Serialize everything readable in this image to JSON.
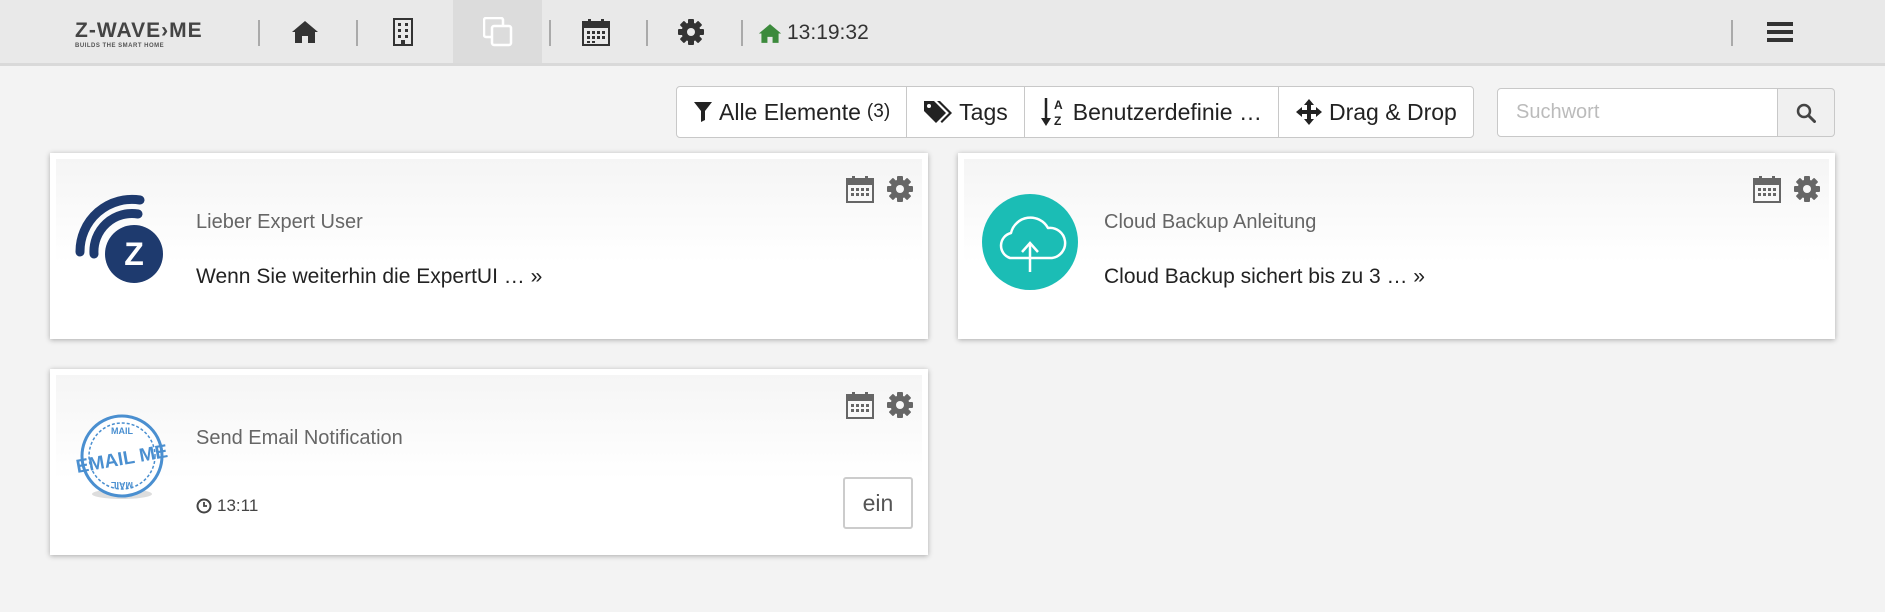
{
  "header": {
    "logo": {
      "name": "Z-WAVE›ME",
      "tagline": "BUILDS THE SMART HOME"
    },
    "nav": [
      {
        "icon": "home-icon"
      },
      {
        "icon": "building-icon"
      },
      {
        "icon": "elements-icon",
        "active": true
      },
      {
        "icon": "calendar-icon"
      },
      {
        "icon": "gear-icon"
      }
    ],
    "clock": {
      "icon": "home-icon",
      "time": "13:19:32",
      "icon_color": "#3c8a3c"
    },
    "menu_icon": "menu-icon"
  },
  "filters": {
    "all": {
      "label": "Alle Elemente",
      "count": "(3)",
      "icon": "filter-icon"
    },
    "tags": {
      "label": "Tags",
      "icon": "tags-icon"
    },
    "sort": {
      "label": "Benutzerdefinie …",
      "icon": "sort-alpha-icon"
    },
    "drag": {
      "label": "Drag & Drop",
      "icon": "move-icon"
    }
  },
  "search": {
    "placeholder": "Suchwort",
    "value": "",
    "icon": "search-icon"
  },
  "cards": [
    {
      "title": "Lieber Expert User",
      "text": "Wenn Sie weiterhin die ExpertUI … »",
      "icon": "zwave-logo-icon"
    },
    {
      "title": "Cloud Backup Anleitung",
      "text": "Cloud Backup sichert bis zu 3 … »",
      "icon": "cloud-upload-icon",
      "icon_color": "#1bbdb5"
    },
    {
      "title": "Send Email Notification",
      "time": "13:11",
      "button": "ein",
      "icon": "email-stamp-icon",
      "stamp_text": "EMAIL ME",
      "stamp_ring": "MAIL"
    }
  ],
  "colors": {
    "accent": "#1bbdb5",
    "zwave_blue": "#1e3a6e",
    "stamp_blue": "#4a8fd0"
  }
}
